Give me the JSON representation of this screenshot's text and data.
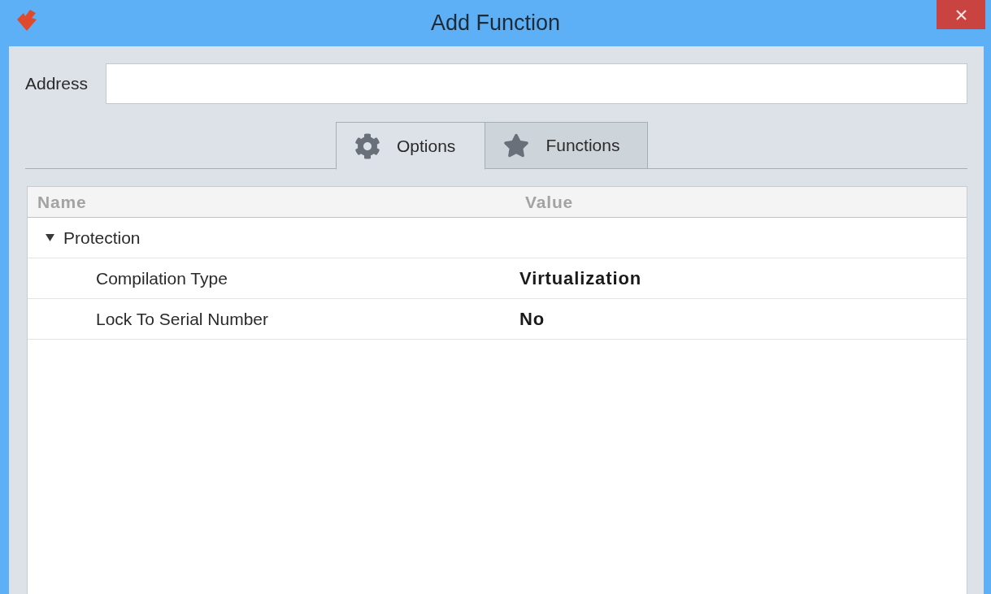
{
  "window": {
    "title": "Add Function"
  },
  "address": {
    "label": "Address"
  },
  "tabs": [
    {
      "label": "Options",
      "selected": true
    },
    {
      "label": "Functions",
      "selected": false
    }
  ],
  "table": {
    "columns": [
      "Name",
      "Value"
    ],
    "rows": [
      {
        "name": "Protection",
        "expanded": true,
        "children": [
          {
            "name": "Compilation Type",
            "value": "Virtualization"
          },
          {
            "name": "Lock To Serial Number",
            "value": "No"
          }
        ]
      }
    ]
  }
}
